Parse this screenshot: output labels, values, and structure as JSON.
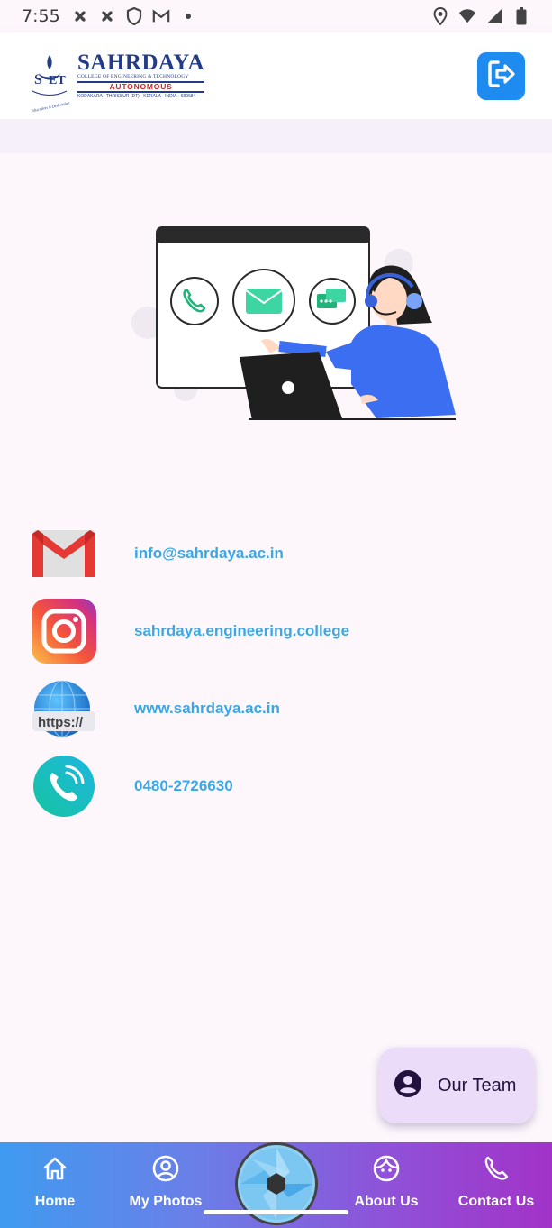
{
  "status_bar": {
    "time": "7:55",
    "left_icons": [
      "fan-icon",
      "fan-icon",
      "shield-icon",
      "gmail-icon",
      "dot-icon"
    ],
    "right_icons": [
      "location-icon",
      "wifi-icon",
      "signal-icon",
      "battery-icon"
    ]
  },
  "header": {
    "logo": {
      "title": "SAHRDAYA",
      "subtitle": "COLLEGE OF ENGINEERING & TECHNOLOGY",
      "badge": "AUTONOMOUS",
      "address": "KODAKARA - THRISSUR (DT) - KERALA - INDIA - 680684",
      "motto": "Education is Dedication"
    },
    "logout_icon": "logout-icon"
  },
  "contacts": [
    {
      "icon": "gmail-icon",
      "text": "info@sahrdaya.ac.in"
    },
    {
      "icon": "instagram-icon",
      "text": "sahrdaya.engineering.college"
    },
    {
      "icon": "web-icon",
      "text": "www.sahrdaya.ac.in",
      "icon_text": "https://"
    },
    {
      "icon": "phone-icon",
      "text": "0480-2726630"
    }
  ],
  "fab": {
    "label": "Our Team",
    "icon": "person-icon"
  },
  "bottom_nav": {
    "items": [
      {
        "label": "Home",
        "icon": "home-icon"
      },
      {
        "label": "My Photos",
        "icon": "account-circle-icon"
      },
      {
        "label": "About Us",
        "icon": "face-icon"
      },
      {
        "label": "Contact Us",
        "icon": "phone-icon"
      }
    ],
    "center_icon": "camera-shutter-icon"
  },
  "colors": {
    "accent": "#1e8bf0",
    "link_text": "#3aa7e6",
    "fab_bg": "#ebddfa",
    "nav_start": "#3f9bf0",
    "nav_end": "#a233c8"
  }
}
